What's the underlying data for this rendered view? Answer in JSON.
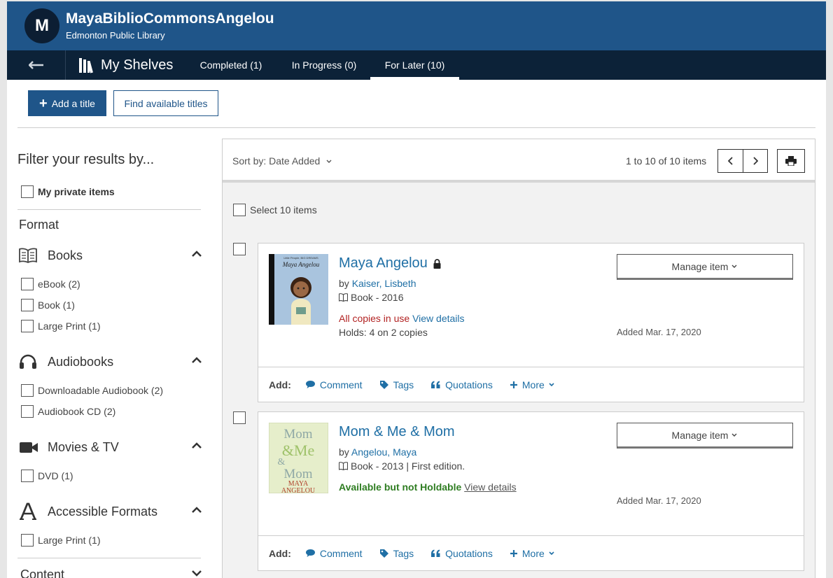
{
  "header": {
    "avatar_initial": "M",
    "username": "MayaBiblioCommonsAngelou",
    "library": "Edmonton Public Library"
  },
  "nav": {
    "title": "My Shelves",
    "tabs": [
      {
        "label": "Completed (1)"
      },
      {
        "label": "In Progress (0)"
      },
      {
        "label": "For Later (10)",
        "active": true
      }
    ]
  },
  "toolbar": {
    "add_label": "Add a title",
    "find_label": "Find available titles"
  },
  "sidebar": {
    "filter_title": "Filter your results by...",
    "private_label": "My private items",
    "format_title": "Format",
    "groups": [
      {
        "label": "Books",
        "icon": "book-icon",
        "options": [
          "eBook (2)",
          "Book (1)",
          "Large Print (1)"
        ]
      },
      {
        "label": "Audiobooks",
        "icon": "headphones-icon",
        "options": [
          "Downloadable Audiobook (2)",
          "Audiobook CD (2)"
        ]
      },
      {
        "label": "Movies & TV",
        "icon": "video-camera-icon",
        "options": [
          "DVD (1)"
        ]
      },
      {
        "label": "Accessible Formats",
        "icon": "font-icon",
        "options": [
          "Large Print (1)"
        ]
      },
      {
        "label": "Content",
        "icon": "",
        "options": []
      }
    ]
  },
  "results": {
    "sort_label": "Sort by: Date Added",
    "count": "1 to 10 of 10 items",
    "select_all": "Select 10 items",
    "add_label": "Add:",
    "actions": [
      "Comment",
      "Tags",
      "Quotations",
      "More"
    ],
    "items": [
      {
        "title": "Maya Angelou",
        "by_prefix": "by",
        "author": "Kaiser, Lisbeth",
        "meta": "Book - 2016",
        "availability": "All copies in use",
        "view_details": "View details",
        "holds": "Holds: 4 on 2 copies",
        "manage": "Manage item",
        "added": "Added Mar. 17, 2020",
        "cover_text": [
          "Little People, BIG DREAMS",
          "Maya Angelou"
        ]
      },
      {
        "title": "Mom & Me & Mom",
        "by_prefix": "by",
        "author": "Angelou, Maya",
        "meta": "Book - 2013 | First edition.",
        "availability": "Available but not Holdable",
        "view_details": "View details",
        "manage": "Manage item",
        "added": "Added Mar. 17, 2020",
        "cover_text": [
          "Mom",
          "&Me",
          "&",
          "Mom",
          "MAYA",
          "ANGELOU"
        ]
      }
    ]
  },
  "colors": {
    "brand": "#1f5589",
    "navbar": "#0c2238",
    "link": "#1f6fa5",
    "unavailable": "#b22222",
    "available": "#2f7d22"
  }
}
